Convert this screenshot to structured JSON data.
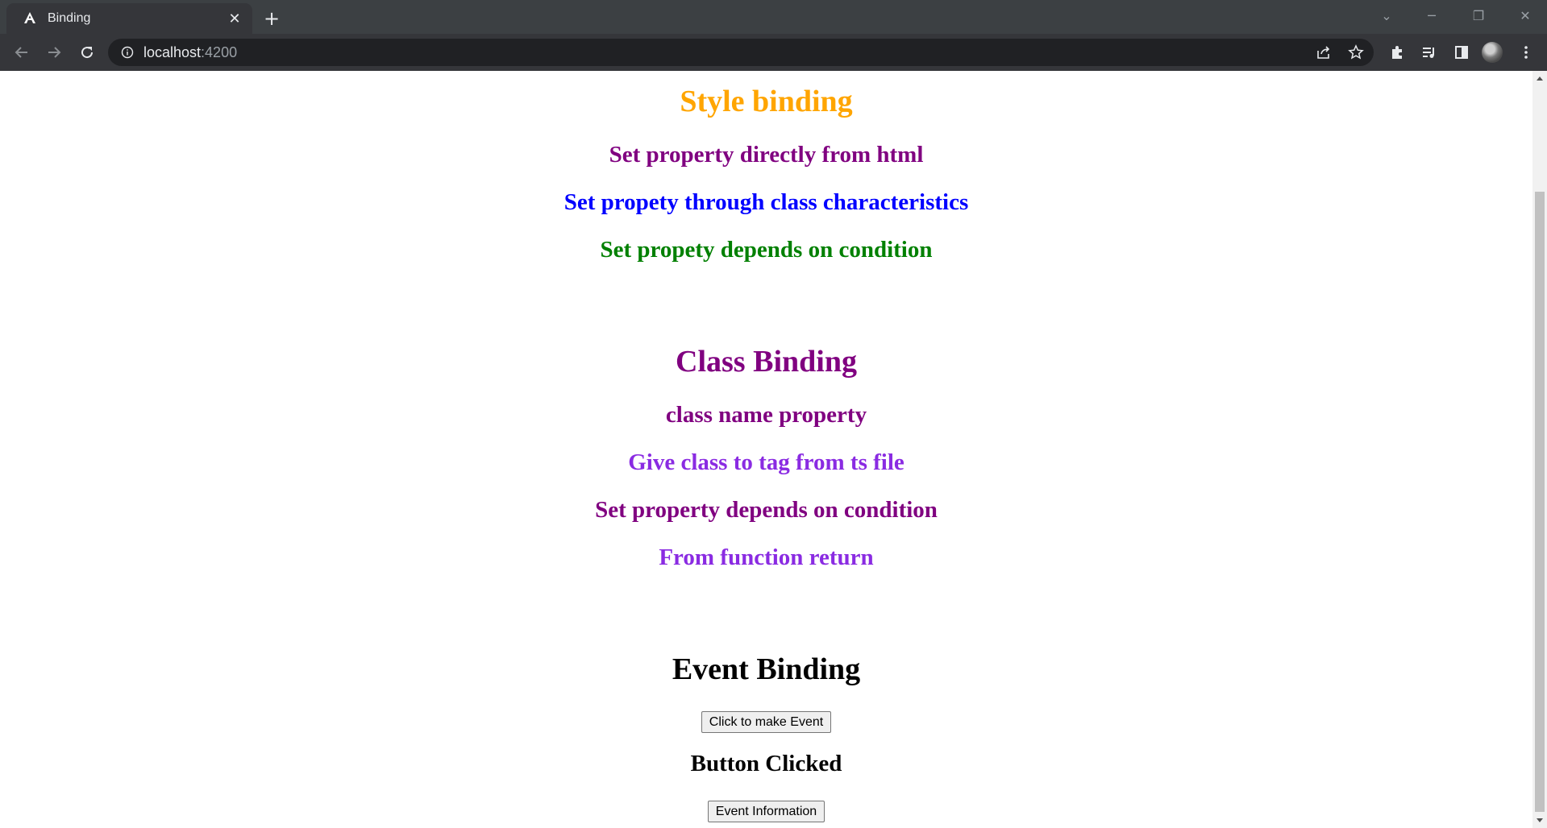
{
  "browser": {
    "tab": {
      "title": "Binding",
      "close_glyph": "✕"
    },
    "new_tab_glyph": "+",
    "url": {
      "host": "localhost",
      "port": ":4200"
    },
    "window_controls": {
      "tab_search": "⌄",
      "minimize": "─",
      "restore": "❐",
      "close": "✕"
    }
  },
  "page": {
    "style_binding": {
      "heading": "Style binding",
      "items": [
        "Set property directly from html",
        "Set propety through class characteristics",
        "Set propety depends on condition"
      ]
    },
    "class_binding": {
      "heading": "Class Binding",
      "items": [
        "class name property",
        "Give class to tag from ts file",
        "Set property depends on condition",
        "From function return"
      ]
    },
    "event_binding": {
      "heading": "Event Binding",
      "button_label": "Click to make Event",
      "status_text": "Button Clicked",
      "info_button_label": "Event Information"
    }
  },
  "colors": {
    "orange": "#ffa500",
    "purple": "#800080",
    "blue": "#0000ff",
    "green": "#008000",
    "violet": "#8a2be2"
  }
}
